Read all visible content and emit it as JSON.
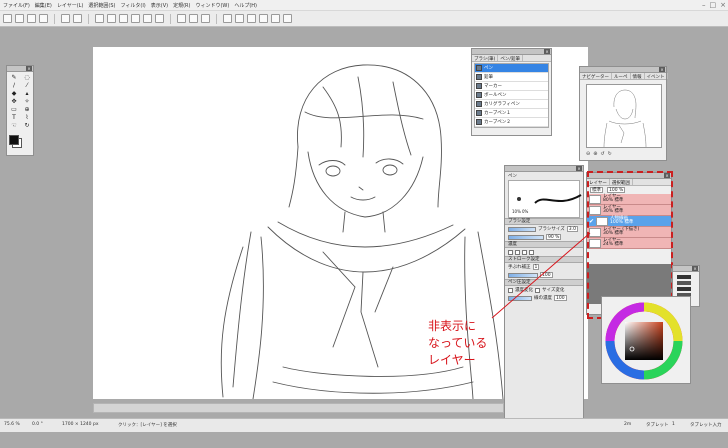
{
  "menubar": {
    "items": [
      "ファイル(F)",
      "編集(E)",
      "レイヤー(L)",
      "選択範囲(S)",
      "フィルタ(I)",
      "表示(V)",
      "定規(R)",
      "ウィンドウ(W)",
      "ヘルプ(H)"
    ]
  },
  "brush_panel": {
    "tabs": [
      "ブラシ(筆)",
      "ペン/鉛筆"
    ],
    "items": [
      "ペン",
      "鉛筆",
      "マーカー",
      "ボールペン",
      "カリグラフィペン",
      "カーブペン１",
      "カーブペン２"
    ]
  },
  "navigator": {
    "tabs": [
      "ナビゲーター",
      "ルーペ",
      "情報",
      "イベント"
    ]
  },
  "brush_settings": {
    "tool_name": "ペン",
    "size_values": [
      "10%",
      "0%"
    ],
    "sections": {
      "brush_settings": "ブラシ設定",
      "stroke_settings": "ストローク設定",
      "density": "濃度",
      "pen_pressure": "ペン圧設定"
    },
    "size_label": "ブラシサイズ",
    "size_value": "3.0",
    "density_value": "90 %",
    "correction_label": "手ぶれ補正",
    "correction_value": "1",
    "size_change_label": "サイズ変化",
    "density_change_label": "濃度変化",
    "value_100": "100",
    "line_density_label": "線の濃度"
  },
  "layer_panel": {
    "tabs": [
      "レイヤー",
      "選択範囲"
    ],
    "blend_mode": "標準",
    "opacity": "100 %",
    "layers": [
      {
        "name": "レイヤー",
        "info": "80% 標準",
        "active": false
      },
      {
        "name": "レイヤー",
        "info": "30% 標準",
        "active": false
      },
      {
        "name": "人物線画",
        "info": "100% 標準",
        "active": true
      },
      {
        "name": "レイヤー (下描き)",
        "info": "30% 標準",
        "active": false
      },
      {
        "name": "レイヤー",
        "info": "24% 標準",
        "active": false
      }
    ]
  },
  "status": {
    "zoom": "75.6 %",
    "rotation": "0.0 °",
    "canvas_size": "1700 × 1240 px",
    "hint": "クリック：[レイヤー] を選択",
    "memory": "2m",
    "tablet_label": "タブレット",
    "tablet_value": "1",
    "tablet_mode": "タブレット入力"
  },
  "annotation": {
    "text": "非表示に\nなっている\nレイヤー"
  },
  "colors": {
    "accent": "#3584e4",
    "highlight": "#cc1f1f",
    "hidden_layer_bg": "#f0b5b5",
    "annotation_text": "#d8141b"
  },
  "icons": {
    "toolbar": [
      "new-file-icon",
      "open-folder-icon",
      "save-icon",
      "print-icon",
      "undo-icon",
      "redo-icon",
      "cut-icon",
      "copy-icon",
      "paste-icon",
      "zoom-in-icon",
      "zoom-out-icon",
      "rotate-left-icon",
      "rotate-right-icon",
      "reset-view-icon"
    ]
  }
}
